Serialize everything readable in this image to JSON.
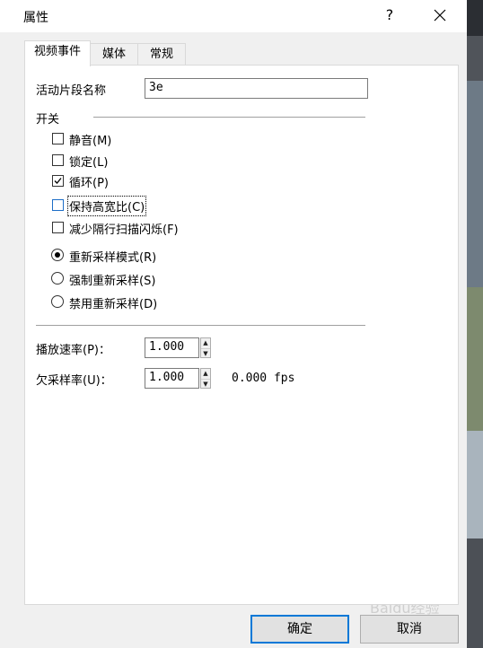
{
  "dialog": {
    "title": "属性",
    "help": "?"
  },
  "tabs": [
    "视频事件",
    "媒体",
    "常规"
  ],
  "clip_name": {
    "label": "活动片段名称",
    "value": "3e"
  },
  "switches": {
    "heading": "开关",
    "checkboxes": [
      {
        "label": "静音(M)",
        "checked": false
      },
      {
        "label": "锁定(L)",
        "checked": false
      },
      {
        "label": "循环(P)",
        "checked": true
      },
      {
        "label": "保持高宽比(C)",
        "checked": false
      },
      {
        "label": "减少隔行扫描闪烁(F)",
        "checked": false
      }
    ],
    "radios": [
      {
        "label": "重新采样模式(R)",
        "selected": true
      },
      {
        "label": "强制重新采样(S)",
        "selected": false
      },
      {
        "label": "禁用重新采样(D)",
        "selected": false
      }
    ]
  },
  "playback_rate": {
    "label": "播放速率(P)：",
    "value": "1.000"
  },
  "undersample_rate": {
    "label": "欠采样率(U)：",
    "value": "1.000",
    "fps": "0.000 fps"
  },
  "buttons": {
    "ok": "确定",
    "cancel": "取消"
  },
  "watermark": "Baidu经验"
}
